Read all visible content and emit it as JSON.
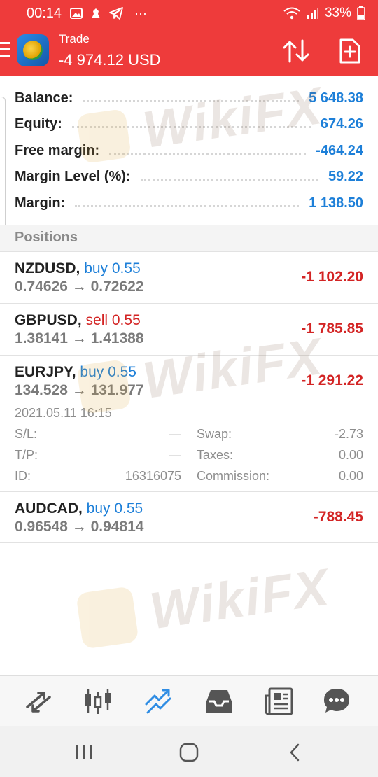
{
  "status_bar": {
    "time": "00:14",
    "battery": "33%",
    "icons": [
      "image-icon",
      "fox-icon",
      "telegram-icon",
      "more-dots-icon",
      "wifi-icon",
      "signal-icon",
      "battery-icon"
    ],
    "more": "···"
  },
  "header": {
    "title": "Trade",
    "profit_total": "-4 974.12 USD"
  },
  "summary": {
    "rows": [
      {
        "label": "Balance:",
        "value": "5 648.38"
      },
      {
        "label": "Equity:",
        "value": "674.26"
      },
      {
        "label": "Free margin:",
        "value": "-464.24"
      },
      {
        "label": "Margin Level (%):",
        "value": "59.22"
      },
      {
        "label": "Margin:",
        "value": "1 138.50"
      }
    ]
  },
  "positions": {
    "header": "Positions",
    "items": [
      {
        "symbol": "NZDUSD,",
        "side": "buy 0.55",
        "prices": "0.74626 → 0.72622",
        "profit": "-1 102.20"
      },
      {
        "symbol": "GBPUSD,",
        "side": "sell 0.55",
        "prices": "1.38141 → 1.41388",
        "profit": "-1 785.85"
      },
      {
        "symbol": "EURJPY,",
        "side": "buy 0.55",
        "prices": "134.528 → 131.977",
        "profit": "-1 291.22"
      },
      {
        "symbol": "AUDCAD,",
        "side": "buy 0.55",
        "prices": "0.96548 → 0.94814",
        "profit": "-788.45"
      }
    ],
    "expanded": {
      "datetime": "2021.05.11 16:15",
      "sl_label": "S/L:",
      "sl_value": "—",
      "tp_label": "T/P:",
      "tp_value": "—",
      "id_label": "ID:",
      "id_value": "16316075",
      "swap_label": "Swap:",
      "swap_value": "-2.73",
      "taxes_label": "Taxes:",
      "taxes_value": "0.00",
      "commission_label": "Commission:",
      "commission_value": "0.00"
    }
  },
  "watermark": "WikiFX",
  "tabs": [
    "quotes-icon",
    "chart-icon",
    "trade-icon",
    "history-icon",
    "news-icon",
    "chat-icon"
  ],
  "colors": {
    "brand_red": "#ee3b3b",
    "value_blue": "#1d7fd8",
    "loss_red": "#d32424",
    "active_tab": "#2f8de4"
  }
}
